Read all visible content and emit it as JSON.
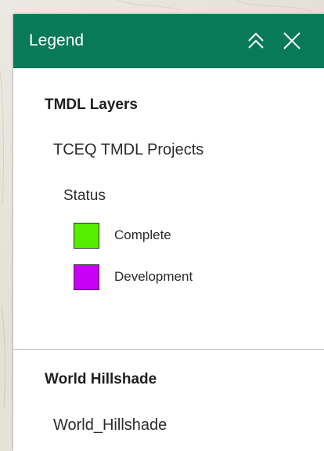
{
  "panel": {
    "title": "Legend",
    "header_color": "#097a58",
    "collapse_icon": "double-chevron-up-icon",
    "close_icon": "close-icon"
  },
  "layers": [
    {
      "title": "TMDL Layers",
      "sublayer": "TCEQ TMDL Projects",
      "field": "Status",
      "items": [
        {
          "label": "Complete",
          "color": "#55ee00"
        },
        {
          "label": "Development",
          "color": "#c800f5"
        }
      ]
    },
    {
      "title": "World Hillshade",
      "sublayer": "World_Hillshade"
    }
  ]
}
